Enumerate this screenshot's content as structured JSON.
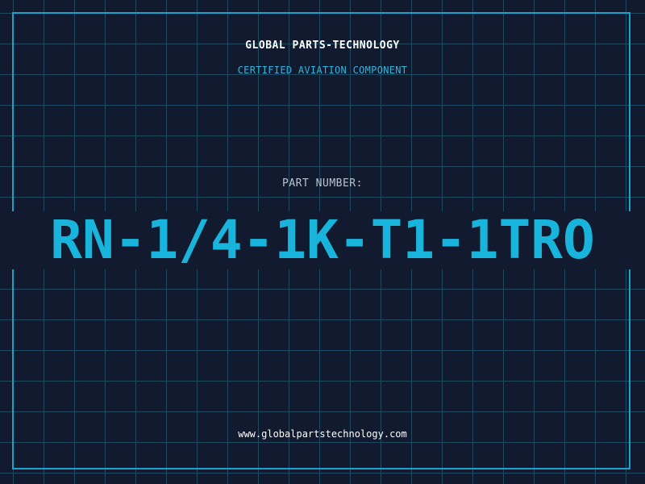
{
  "header": {
    "company": "GLOBAL PARTS-TECHNOLOGY",
    "subtitle": "CERTIFIED AVIATION COMPONENT"
  },
  "part": {
    "label": "PART NUMBER:",
    "number": "RN-1/4-1K-T1-1TRO"
  },
  "footer": {
    "website": "www.globalpartstechnology.com"
  },
  "colors": {
    "background": "#111a2e",
    "grid": "#1e4a60",
    "accent": "#19b4db",
    "frame": "#1aa3c8"
  }
}
